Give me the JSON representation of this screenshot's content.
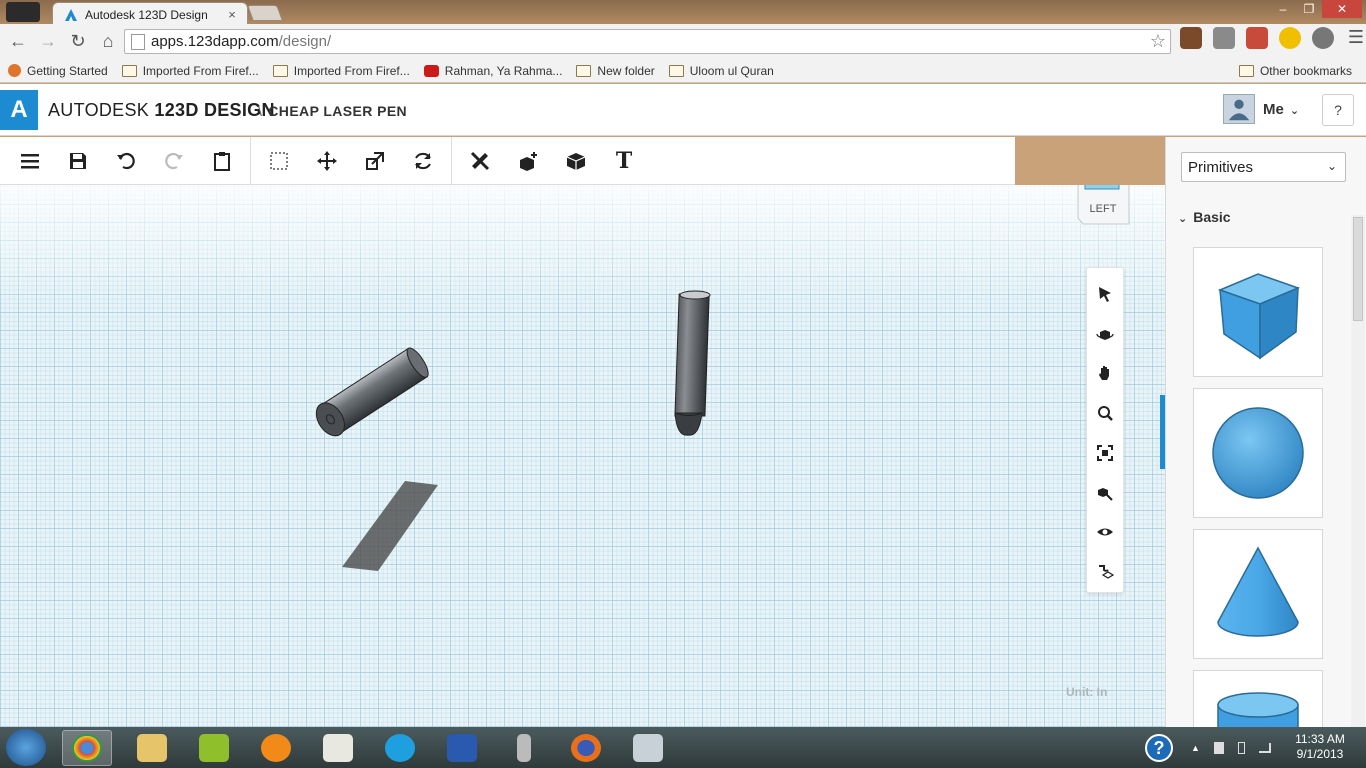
{
  "browser": {
    "tab_title": "Autodesk 123D Design",
    "tab_close": "×",
    "url_host": "apps.123dapp.com",
    "url_path": "/design/",
    "window_controls": [
      "–",
      "❐",
      "✕"
    ]
  },
  "bookmarks": [
    {
      "label": "Getting Started",
      "icon": "firefox-icon"
    },
    {
      "label": "Imported From Firef...",
      "icon": "folder-icon"
    },
    {
      "label": "Imported From Firef...",
      "icon": "folder-icon"
    },
    {
      "label": "Rahman, Ya Rahma...",
      "icon": "youtube-icon"
    },
    {
      "label": "New folder",
      "icon": "folder-icon"
    },
    {
      "label": "Uloom ul Quran",
      "icon": "folder-icon"
    }
  ],
  "other_bookmarks": "Other bookmarks",
  "app": {
    "logo_letter": "A",
    "brand_light": "AUTODESK",
    "brand_bold": "123D",
    "brand_bold2": "DESIGN",
    "separator": "\\",
    "project_name": "CHEAP LASER PEN",
    "user_label": "Me",
    "help_label": "?"
  },
  "toolbar": {
    "text_tool": "T"
  },
  "viewport": {
    "viewcube_face": "LEFT",
    "unit_label": "Unit:",
    "unit_value": "In"
  },
  "right_panel": {
    "dropdown_value": "Primitives",
    "section_label": "Basic",
    "primitives": [
      "box",
      "sphere",
      "cone",
      "cylinder"
    ]
  },
  "taskbar": {
    "time": "11:33 AM",
    "date": "9/1/2013",
    "help_glyph": "?"
  },
  "colors": {
    "accent": "#1d8bd1",
    "primitive_blue": "#4aa8e8"
  }
}
